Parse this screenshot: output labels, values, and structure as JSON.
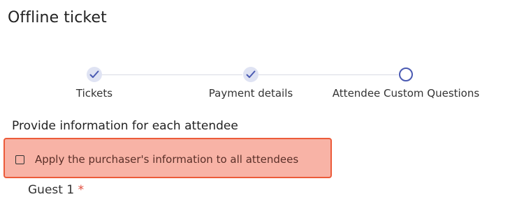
{
  "page": {
    "title": "Offline ticket"
  },
  "stepper": {
    "steps": [
      {
        "label": "Tickets",
        "status": "completed"
      },
      {
        "label": "Payment details",
        "status": "completed"
      },
      {
        "label": "Attendee Custom Questions",
        "status": "current"
      }
    ],
    "accent_color": "#4a5ab2"
  },
  "form": {
    "section_heading": "Provide information for each attendee",
    "apply_purchaser": {
      "label": "Apply the purchaser's information to all attendees",
      "checked": false,
      "highlight_color": "#f8b3a6",
      "border_color": "#ec5b3a"
    },
    "next_field": {
      "label": "Guest 1",
      "required_mark": "*"
    }
  }
}
